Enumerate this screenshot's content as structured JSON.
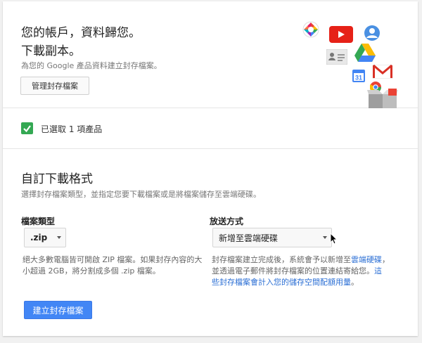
{
  "hero": {
    "title_line1": "您的帳戶，資料歸您。",
    "title_line2": "下載副本。",
    "subtitle": "為您的 Google 產品資料建立封存檔案。",
    "manage_button": "管理封存檔案",
    "product_icons": [
      "picasa-icon",
      "youtube-icon",
      "profile-icon",
      "contacts-icon",
      "drive-icon",
      "calendar-icon",
      "gmail-icon",
      "chrome-icon",
      "archive-box-icon"
    ]
  },
  "selected": {
    "checked": true,
    "label": "已選取 1 項產品"
  },
  "format": {
    "title": "自訂下載格式",
    "description": "選擇封存檔案類型，並指定您要下載檔案或是將檔案儲存至雲端硬碟。",
    "file_type_label": "檔案類型",
    "file_type_value": ".zip",
    "file_type_note_line1": "絕大多數電腦皆可開啟 ZIP 檔案。如果封存內容的大",
    "file_type_note_line2": "小超過 2GB，將分割成多個 .zip 檔案。",
    "delivery_label": "放送方式",
    "delivery_value": "新增至雲端硬碟",
    "delivery_note_line1_a": "封存檔案建立完成後，系統會予以新增至",
    "delivery_note_line1_link": "雲端硬碟",
    "delivery_note_line1_b": "，",
    "delivery_note_line2_a": "並透過電子郵件將封存檔案的位置連結寄給您。",
    "delivery_note_line2_link": "這",
    "delivery_note_line3_link": "些封存檔案會計入您的儲存空間配額用量",
    "delivery_note_line3_b": "。",
    "create_button": "建立封存檔案"
  },
  "colors": {
    "accent_blue": "#4286f5",
    "link_blue": "#2a6ed4",
    "check_green": "#34a853"
  }
}
